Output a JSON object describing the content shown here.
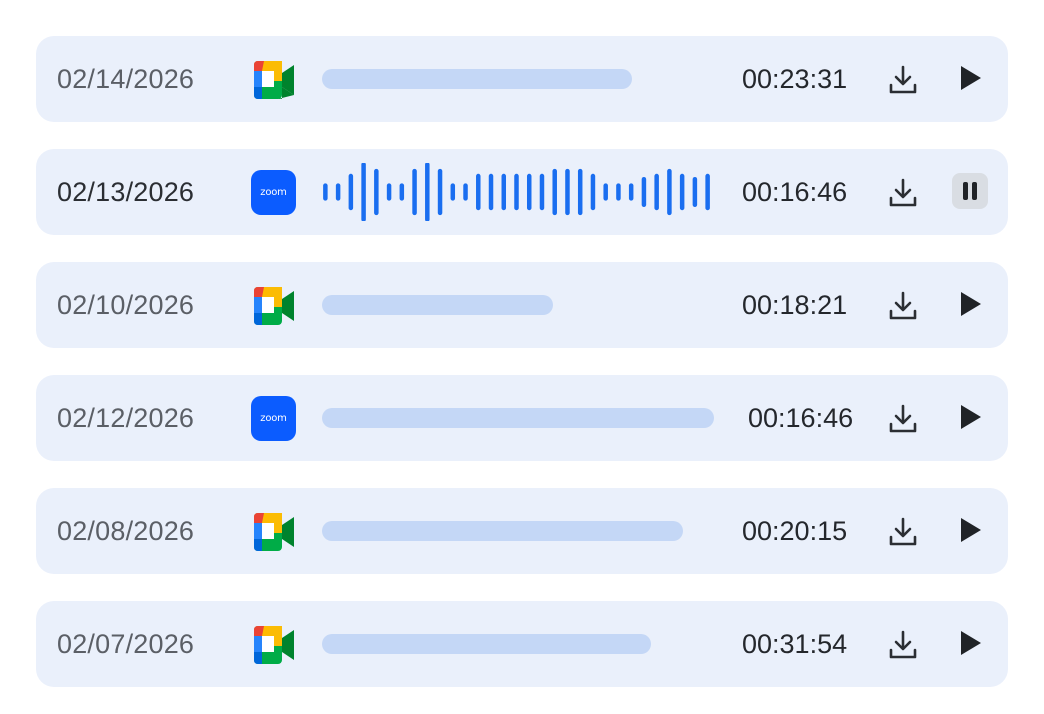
{
  "recordings": [
    {
      "date": "02/14/2026",
      "platform": "google-meet",
      "duration": "00:23:31",
      "progress": 0.79,
      "state": "play"
    },
    {
      "date": "02/13/2026",
      "platform": "zoom",
      "duration": "00:16:46",
      "progress": null,
      "state": "pause",
      "waveform": [
        0.22,
        0.22,
        0.55,
        0.95,
        0.72,
        0.22,
        0.22,
        0.72,
        0.95,
        0.72,
        0.22,
        0.22,
        0.55,
        0.55,
        0.55,
        0.55,
        0.55,
        0.55,
        0.72,
        0.72,
        0.72,
        0.55,
        0.22,
        0.22,
        0.22,
        0.44,
        0.55,
        0.72,
        0.55,
        0.44,
        0.55
      ]
    },
    {
      "date": "02/10/2026",
      "platform": "google-meet",
      "duration": "00:18:21",
      "progress": 0.59,
      "state": "play"
    },
    {
      "date": "02/12/2026",
      "platform": "zoom",
      "duration": "00:16:46",
      "progress": 1.0,
      "state": "play"
    },
    {
      "date": "02/08/2026",
      "platform": "google-meet",
      "duration": "00:20:15",
      "progress": 0.92,
      "state": "play"
    },
    {
      "date": "02/07/2026",
      "platform": "google-meet",
      "duration": "00:31:54",
      "progress": 0.84,
      "state": "play"
    }
  ],
  "zoom_logo_text": "zoom",
  "icons": {
    "download": "download-icon",
    "play": "play-icon",
    "pause": "pause-icon",
    "google_meet": "google-meet-icon",
    "zoom": "zoom-icon"
  },
  "colors": {
    "row_bg": "#eaf0fb",
    "bar": "#c4d7f6",
    "waveform": "#1a6ef0",
    "zoom_blue": "#0b5cff"
  }
}
